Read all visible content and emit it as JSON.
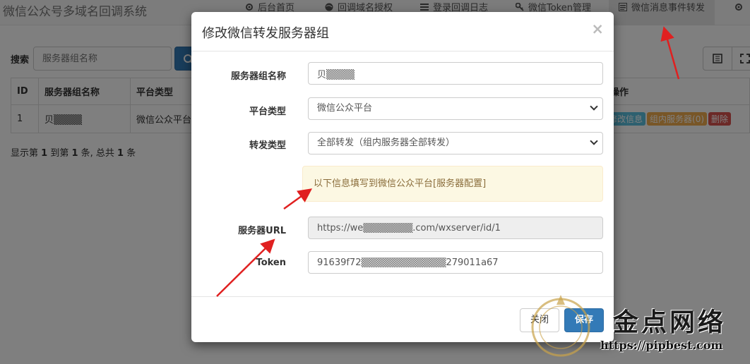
{
  "app": {
    "brand": "微信公众号多域名回调系统",
    "nav": [
      {
        "label": "后台首页",
        "icon": "gear-icon"
      },
      {
        "label": "回调域名授权",
        "icon": "globe-icon"
      },
      {
        "label": "登录回调日志",
        "icon": "list-icon"
      },
      {
        "label": "微信Token管理",
        "icon": "key-icon"
      },
      {
        "label": "微信消息事件转发",
        "icon": "list-alt-icon"
      }
    ]
  },
  "toolbar": {
    "search_label": "搜索",
    "search_placeholder": "服务器组名称"
  },
  "table": {
    "headers": [
      "ID",
      "服务器组名称",
      "平台类型",
      "操作"
    ],
    "rows": [
      {
        "id": "1",
        "name": "贝▒▒▒▒",
        "platform": "微信公众平台",
        "actions": [
          "修改信息",
          "组内服务器(0)",
          "删除"
        ]
      }
    ]
  },
  "pagination": {
    "text_prefix": "显示第 ",
    "from": "1",
    "text_mid1": " 到第 ",
    "to": "1",
    "text_mid2": " 条, 总共 ",
    "total": "1",
    "text_suffix": " 条"
  },
  "modal": {
    "title": "修改微信转发服务器组",
    "close_glyph": "×",
    "fields": {
      "group_name": {
        "label": "服务器组名称",
        "value": "贝▒▒▒▒"
      },
      "platform": {
        "label": "平台类型",
        "value": "微信公众平台"
      },
      "forward_type": {
        "label": "转发类型",
        "value": "全部转发（组内服务器全部转发）"
      },
      "server_url": {
        "label": "服务器URL",
        "value": "https://we▒▒▒▒▒▒▒.com/wxserver/id/1"
      },
      "token": {
        "label": "Token",
        "value": "91639f72▒▒▒▒▒▒▒▒▒▒▒▒279011a67"
      }
    },
    "notice": "以下信息填写到微信公众平台[服务器配置]",
    "buttons": {
      "close": "关闭",
      "save": "保存"
    }
  },
  "watermark": {
    "text": "金点网络",
    "url": "https://pipbest.com"
  },
  "colors": {
    "primary": "#337ab7",
    "arrow": "#e02020",
    "alert_bg": "#fcf8e3",
    "alert_text": "#8a6d3b"
  }
}
